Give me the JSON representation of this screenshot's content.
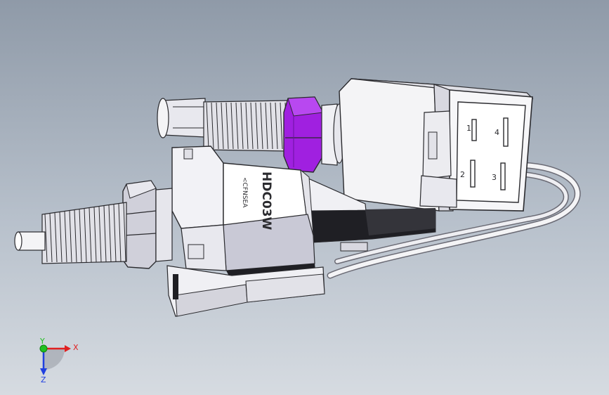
{
  "model": {
    "housing_marking": "HDC03W",
    "brand_marking": "<CFNSEA",
    "pin_labels": [
      "1",
      "4",
      "2",
      "3"
    ]
  },
  "triad": {
    "x_label": "X",
    "y_label": "Y",
    "z_label": "Z"
  },
  "colors": {
    "background_top": "#8f9aa8",
    "background_bottom": "#d6dbe1",
    "body": "#f4f4f6",
    "shade": "#c9c9d6",
    "dark": "#2a2a2e",
    "nut_highlight": "#a020e0",
    "x_axis": "#e02020",
    "y_axis": "#20c020",
    "z_axis": "#2040e0"
  }
}
